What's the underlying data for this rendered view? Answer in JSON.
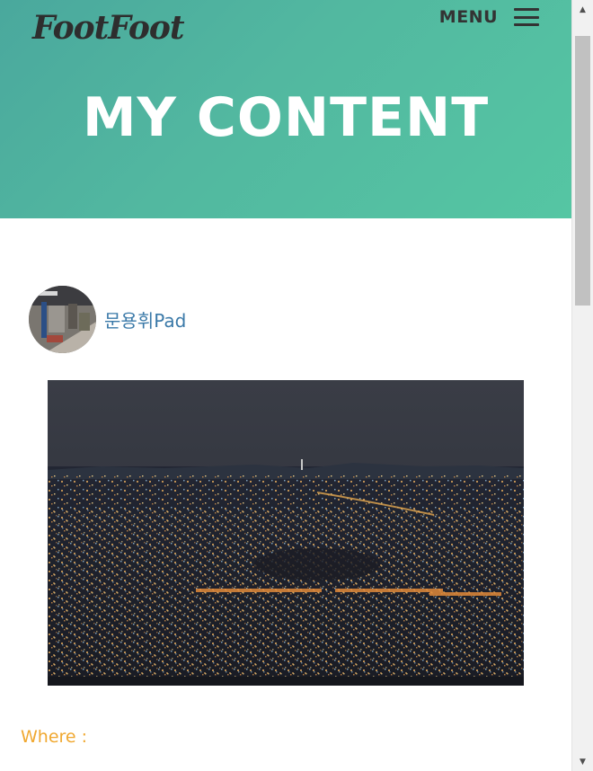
{
  "header": {
    "logo": "FootFoot",
    "menu_label": "MENU",
    "menu_icon": "hamburger-icon",
    "title": "MY CONTENT"
  },
  "post": {
    "author_name": "문용휘Pad",
    "avatar_icon": "avatar",
    "image_alt": "night city skyline",
    "where_label": "Where :"
  },
  "colors": {
    "hero_gradient_start": "#4aa89d",
    "hero_gradient_end": "#55c6a3",
    "author_link": "#3a79a8",
    "where_label": "#f0a830"
  }
}
